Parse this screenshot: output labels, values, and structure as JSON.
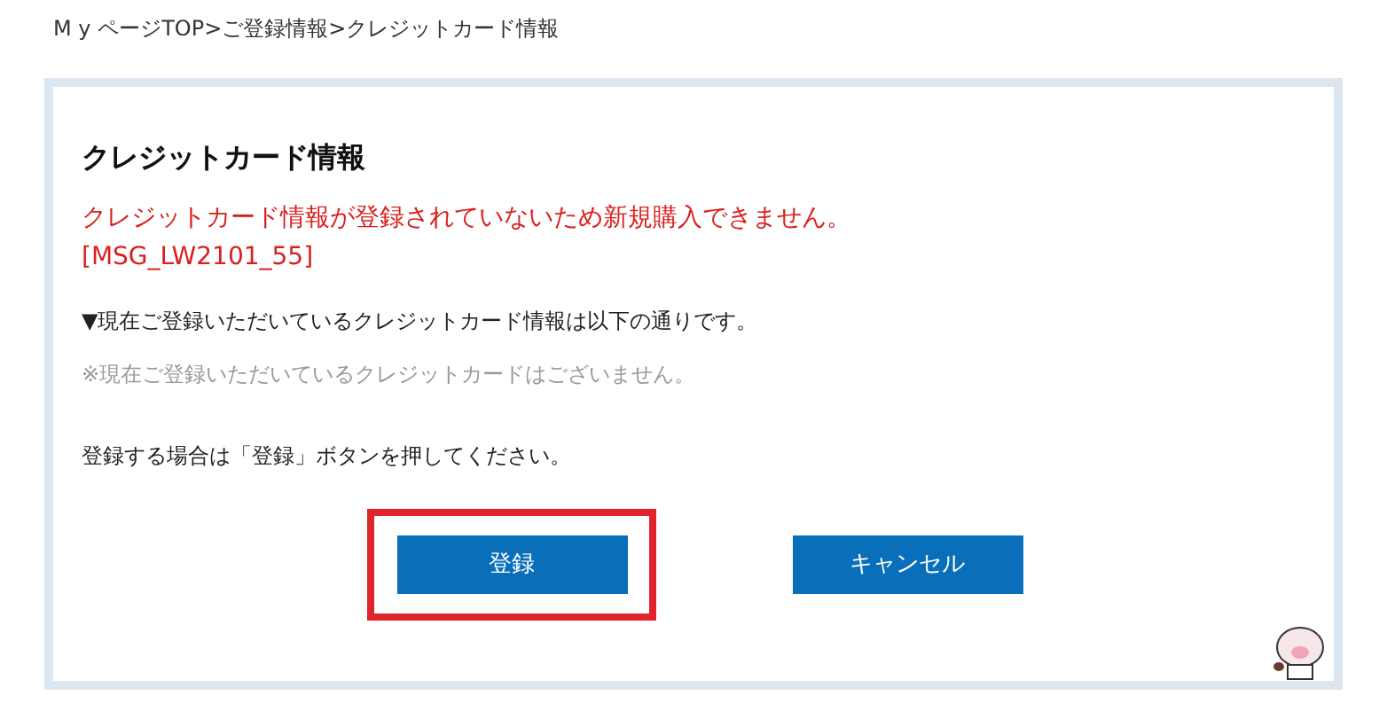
{
  "breadcrumb": [
    "M y ページTOP",
    "ご登録情報",
    "クレジットカード情報"
  ],
  "breadcrumb_separator": ">",
  "panel": {
    "title": "クレジットカード情報",
    "error_message": "クレジットカード情報が登録されていないため新規購入できません。",
    "error_code": "[MSG_LW2101_55]",
    "lead": "▼現在ご登録いただいているクレジットカード情報は以下の通りです。",
    "empty_note": "※現在ご登録いただいているクレジットカードはございません。",
    "instruction": "登録する場合は「登録」ボタンを押してください。",
    "buttons": [
      {
        "label": "登録",
        "highlighted": true
      },
      {
        "label": "キャンセル",
        "highlighted": false
      }
    ]
  }
}
